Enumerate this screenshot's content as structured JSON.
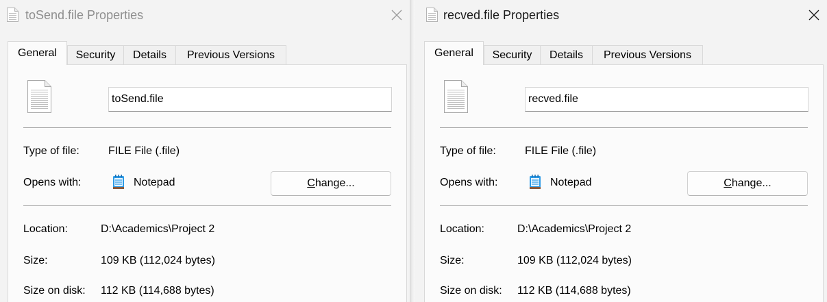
{
  "windows": [
    {
      "title": "toSend.file Properties",
      "tabs": [
        {
          "label": "General",
          "active": true
        },
        {
          "label": "Security",
          "active": false
        },
        {
          "label": "Details",
          "active": false
        },
        {
          "label": "Previous Versions",
          "active": false
        }
      ],
      "filename": "toSend.file",
      "type_label": "Type of file:",
      "type_value": "FILE File (.file)",
      "opens_label": "Opens with:",
      "opens_value": "Notepad",
      "change_mnemonic": "C",
      "change_rest": "hange...",
      "location_label": "Location:",
      "location_value": "D:\\Academics\\Project 2",
      "size_label": "Size:",
      "size_value": "109 KB (112,024 bytes)",
      "size_disk_label": "Size on disk:",
      "size_disk_value": "112 KB (114,688 bytes)",
      "focused": false
    },
    {
      "title": "recved.file Properties",
      "tabs": [
        {
          "label": "General",
          "active": true
        },
        {
          "label": "Security",
          "active": false
        },
        {
          "label": "Details",
          "active": false
        },
        {
          "label": "Previous Versions",
          "active": false
        }
      ],
      "filename": "recved.file",
      "type_label": "Type of file:",
      "type_value": "FILE File (.file)",
      "opens_label": "Opens with:",
      "opens_value": "Notepad",
      "change_mnemonic": "C",
      "change_rest": "hange...",
      "location_label": "Location:",
      "location_value": "D:\\Academics\\Project 2",
      "size_label": "Size:",
      "size_value": "109 KB (112,024 bytes)",
      "size_disk_label": "Size on disk:",
      "size_disk_value": "112 KB (114,688 bytes)",
      "focused": true
    }
  ],
  "colors": {
    "title_inactive": "#8e8e8e",
    "title_active": "#1a1a1a",
    "notepad_blue": "#2e9be6",
    "notepad_bar": "#8a5a3c"
  },
  "icons": {
    "title": "document-icon",
    "close": "close-icon",
    "file": "generic-file-icon",
    "opens_with": "notepad-icon"
  }
}
